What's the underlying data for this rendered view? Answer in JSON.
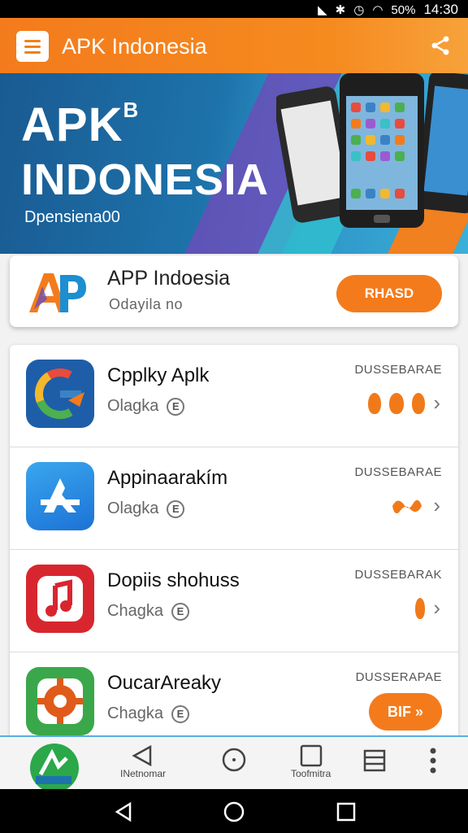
{
  "status_bar": {
    "battery": "50%",
    "time": "14:30"
  },
  "app_bar": {
    "title": "APK Indonesia",
    "menu_icon": "hamburger-menu-icon",
    "share_icon": "share-icon"
  },
  "hero": {
    "title_line1": "APK",
    "title_line1_suffix": "B",
    "title_line2": "INDONESIA",
    "subtitle": "Dpensiena00"
  },
  "featured": {
    "title": "APP Indoesia",
    "subtitle": "Odayila  no",
    "button": "RHASD"
  },
  "apps": [
    {
      "title": "Cpplky Aplk",
      "subtitle": "Olagka",
      "badge": "E",
      "category": "DUSSEBARAE",
      "icon": "google-icon"
    },
    {
      "title": "Appinaarakím",
      "subtitle": "Olagka",
      "badge": "E",
      "category": "DUSSEBARAE",
      "icon": "appstore-icon"
    },
    {
      "title": "Dopiis shohuss",
      "subtitle": "Chagka",
      "badge": "E",
      "category": "DUSSEBARAK",
      "icon": "music-icon"
    },
    {
      "title": "OucarAreaky",
      "subtitle": "Chagka",
      "badge": "E",
      "category": "DUSSERAPAE",
      "icon": "settings-gear-icon",
      "button": "BIF »"
    }
  ],
  "bottom_nav": {
    "item1_label": "INetnomar",
    "item3_label": "Toofmitra"
  },
  "colors": {
    "accent": "#f47b1c",
    "hero_blue": "#1d73ab"
  }
}
